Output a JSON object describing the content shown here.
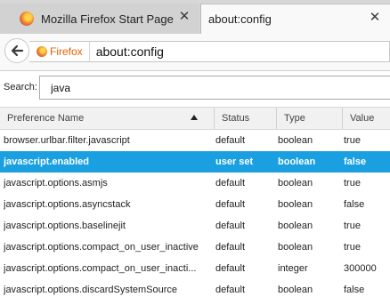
{
  "colors": {
    "accent_selection": "#1aa0e0",
    "firefox_label": "#e66000"
  },
  "tabs": [
    {
      "title": "Mozilla Firefox Start Page",
      "icon": "firefox-icon",
      "active": false
    },
    {
      "title": "about:config",
      "active": true
    }
  ],
  "navbar": {
    "back_icon": "back-arrow-icon",
    "identity_label": "Firefox",
    "url": "about:config"
  },
  "search": {
    "label": "Search:",
    "value": "java"
  },
  "table": {
    "columns": [
      "Preference Name",
      "Status",
      "Type",
      "Value"
    ],
    "sort_column": "Preference Name",
    "rows": [
      {
        "name": "browser.urlbar.filter.javascript",
        "status": "default",
        "type": "boolean",
        "value": "true"
      },
      {
        "name": "javascript.enabled",
        "status": "user set",
        "type": "boolean",
        "value": "false",
        "selected": true
      },
      {
        "name": "javascript.options.asmjs",
        "status": "default",
        "type": "boolean",
        "value": "true"
      },
      {
        "name": "javascript.options.asyncstack",
        "status": "default",
        "type": "boolean",
        "value": "false"
      },
      {
        "name": "javascript.options.baselinejit",
        "status": "default",
        "type": "boolean",
        "value": "true"
      },
      {
        "name": "javascript.options.compact_on_user_inactive",
        "status": "default",
        "type": "boolean",
        "value": "true"
      },
      {
        "name": "javascript.options.compact_on_user_inacti...",
        "status": "default",
        "type": "integer",
        "value": "300000"
      },
      {
        "name": "javascript.options.discardSystemSource",
        "status": "default",
        "type": "boolean",
        "value": "false"
      }
    ]
  }
}
